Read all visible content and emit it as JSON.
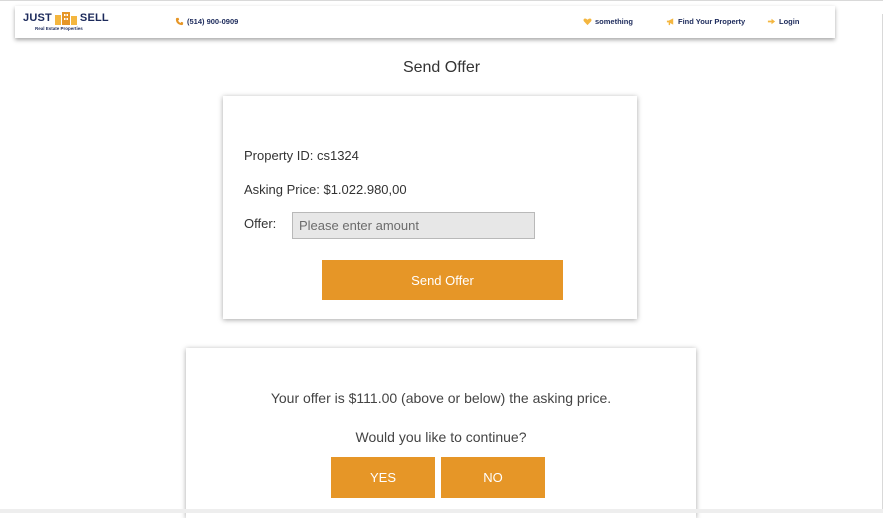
{
  "header": {
    "logo": {
      "word_left": "JUST",
      "word_right": "SELL",
      "subtitle": "Real Estate Properties"
    },
    "phone": "(514) 900-0909",
    "nav": {
      "favorites": "something",
      "find_property": "Find Your Property",
      "login": "Login"
    }
  },
  "page": {
    "title": "Send Offer"
  },
  "offer_card": {
    "property_id": "Property ID: cs1324",
    "asking_price": "Asking Price: $1.022.980,00",
    "offer_label": "Offer:",
    "offer_value": "",
    "offer_placeholder": "Please enter amount",
    "send_button": "Send Offer"
  },
  "confirm_dialog": {
    "message": "Your offer is $111.00 (above or below) the asking price.",
    "question": "Would you like to continue?",
    "yes_button": "YES",
    "no_button": "NO"
  },
  "colors": {
    "accent": "#e69627",
    "brand_navy": "#1c2a5b",
    "brand_yellow": "#f4b63f",
    "input_bg": "#e7e7e7"
  },
  "icons": {
    "phone": "phone-icon",
    "favorites": "heart-icon",
    "find_property": "megaphone-icon",
    "login": "login-arrow-icon"
  }
}
